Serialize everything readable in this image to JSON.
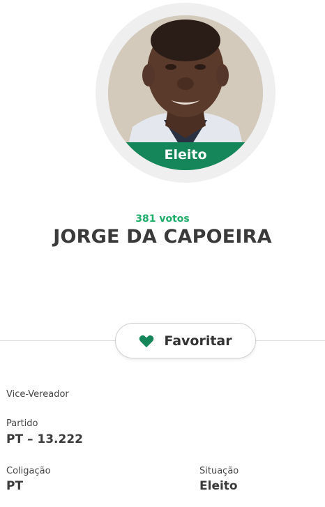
{
  "candidate": {
    "status_badge": "Eleito",
    "votes": "381 votos",
    "name": "JORGE DA CAPOEIRA"
  },
  "actions": {
    "favorite_label": "Favoritar",
    "favorite_icon": "heart-icon"
  },
  "details": {
    "role": "Vice-Vereador",
    "party_label": "Partido",
    "party_value": "PT – 13.222",
    "coalition_label": "Coligação",
    "coalition_value": "PT",
    "situation_label": "Situação",
    "situation_value": "Eleito"
  },
  "colors": {
    "accent_green": "#14865a",
    "votes_green": "#1fae6a",
    "text_dark": "#3a3a3a"
  }
}
